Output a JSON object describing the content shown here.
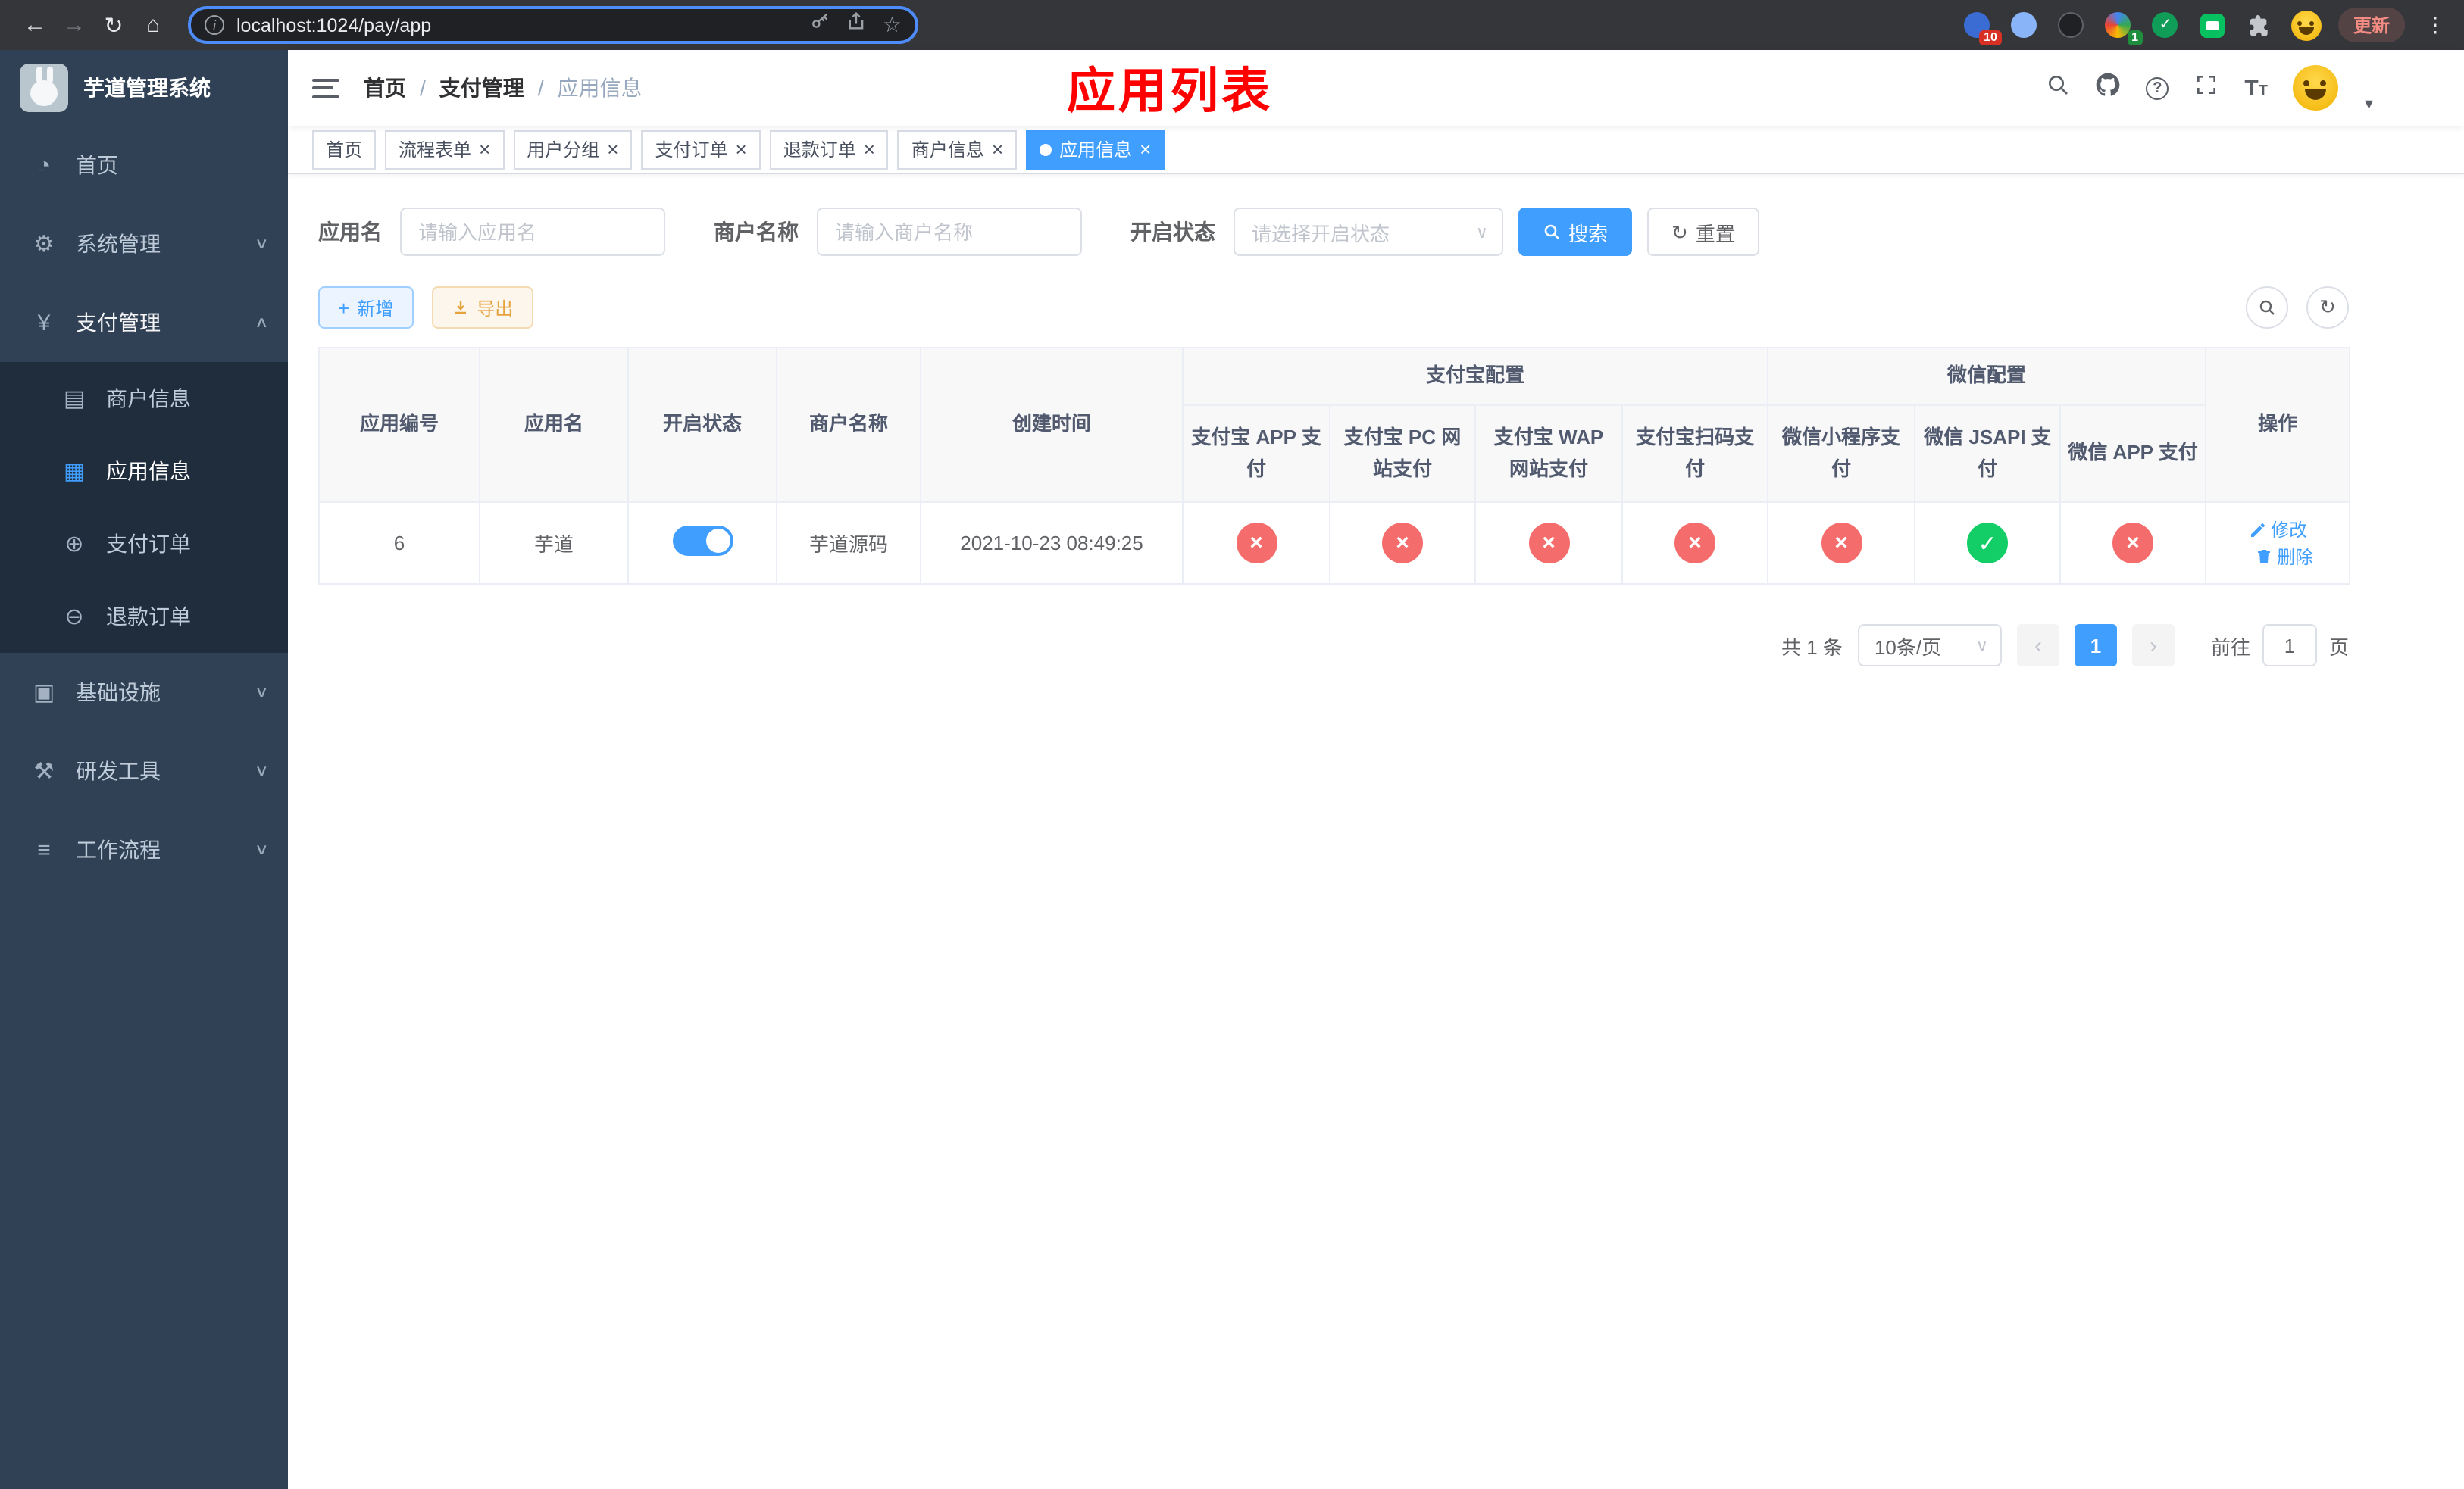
{
  "browser": {
    "url": "localhost:1024/pay/app",
    "update_button": "更新",
    "ext_badge_1": "10",
    "ext_badge_2": "1"
  },
  "icons": {
    "back": "←",
    "forward": "→",
    "reload": "↻",
    "home": "⌂",
    "site_info": "i",
    "bookmark_star": "☆",
    "kebab_menu": "⋮",
    "check": "✓",
    "dashboard": "◔",
    "system": "⚙",
    "payment": "¥",
    "merchant": "▤",
    "app": "▦",
    "pay_order": "⊕",
    "refund_order": "⊖",
    "infra": "▣",
    "devtools": "⚒",
    "workflow": "≡",
    "chevron_down": "∨",
    "chevron_up": "∧",
    "close": "×",
    "caret_down": "▾",
    "help": "?",
    "plus": "+",
    "refresh": "↻",
    "prev": "‹",
    "next": "›",
    "font_large": "T"
  },
  "sidebar": {
    "logo_title": "芋道管理系统",
    "menu": [
      {
        "label": "首页"
      },
      {
        "label": "系统管理"
      },
      {
        "label": "支付管理",
        "children": [
          {
            "label": "商户信息"
          },
          {
            "label": "应用信息",
            "active": true
          },
          {
            "label": "支付订单"
          },
          {
            "label": "退款订单"
          }
        ]
      },
      {
        "label": "基础设施"
      },
      {
        "label": "研发工具"
      },
      {
        "label": "工作流程"
      }
    ]
  },
  "navbar": {
    "breadcrumb": [
      "首页",
      "支付管理",
      "应用信息"
    ],
    "separator": "/",
    "page_title": "应用列表"
  },
  "tabs": [
    {
      "label": "首页",
      "closable": false,
      "active": false
    },
    {
      "label": "流程表单",
      "closable": true,
      "active": false
    },
    {
      "label": "用户分组",
      "closable": true,
      "active": false
    },
    {
      "label": "支付订单",
      "closable": true,
      "active": false
    },
    {
      "label": "退款订单",
      "closable": true,
      "active": false
    },
    {
      "label": "商户信息",
      "closable": true,
      "active": false
    },
    {
      "label": "应用信息",
      "closable": true,
      "active": true
    }
  ],
  "filters": {
    "app_name_label": "应用名",
    "app_name_placeholder": "请输入应用名",
    "merchant_label": "商户名称",
    "merchant_placeholder": "请输入商户名称",
    "status_label": "开启状态",
    "status_placeholder": "请选择开启状态",
    "search_button": "搜索",
    "reset_button": "重置"
  },
  "toolbar": {
    "add_button": "新增",
    "export_button": "导出"
  },
  "table": {
    "headers": {
      "app_id": "应用编号",
      "app_name": "应用名",
      "status": "开启状态",
      "merchant_name": "商户名称",
      "create_time": "创建时间",
      "alipay_group": "支付宝配置",
      "alipay_app": "支付宝 APP 支付",
      "alipay_pc": "支付宝 PC 网站支付",
      "alipay_wap": "支付宝 WAP 网站支付",
      "alipay_qr": "支付宝扫码支付",
      "wechat_group": "微信配置",
      "wechat_mini": "微信小程序支付",
      "wechat_jsapi": "微信 JSAPI 支付",
      "wechat_app": "微信 APP 支付",
      "actions": "操作"
    },
    "rows": [
      {
        "app_id": "6",
        "app_name": "芋道",
        "status_enabled": true,
        "merchant_name": "芋道源码",
        "create_time": "2021-10-23 08:49:25",
        "pay": {
          "alipay_app": false,
          "alipay_pc": false,
          "alipay_wap": false,
          "alipay_qr": false,
          "wechat_mini": false,
          "wechat_jsapi": true,
          "wechat_app": false
        },
        "edit_label": "修改",
        "delete_label": "删除"
      }
    ]
  },
  "pagination": {
    "total_text": "共 1 条",
    "page_size": "10条/页",
    "current_page": "1",
    "goto_label": "前往",
    "goto_value": "1",
    "page_suffix": "页"
  },
  "colors": {
    "primary": "#409eff",
    "danger": "#f56c6c",
    "success": "#13ce66",
    "title_red": "#ff0000",
    "sidebar_bg": "#304156",
    "submenu_bg": "#1f2d3d"
  }
}
